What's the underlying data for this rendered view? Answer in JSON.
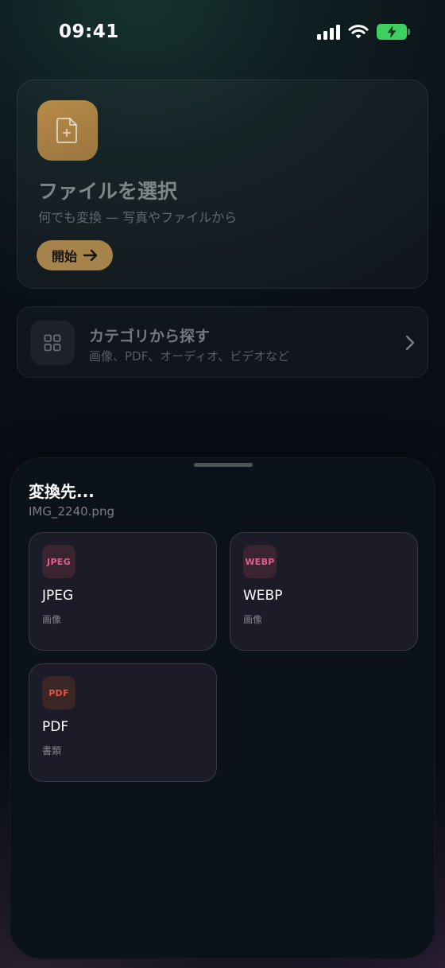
{
  "status": {
    "time": "09:41",
    "battery_color": "#3ecf62"
  },
  "picker": {
    "title": "ファイルを選択",
    "subtitle": "何でも変換 — 写真やファイルから",
    "start_label": "開始",
    "icon": "file-plus-icon",
    "accent": "#a7834c"
  },
  "category": {
    "title": "カテゴリから探す",
    "subtitle": "画像、PDF、オーディオ、ビデオなど",
    "icon": "grid-icon"
  },
  "sheet": {
    "title": "変換先...",
    "file_name": "IMG_2240.png",
    "formats": [
      {
        "badge": "JPEG",
        "name": "JPEG",
        "type": "画像",
        "color": "#e0608c",
        "bg": "#3a2430"
      },
      {
        "badge": "WEBP",
        "name": "WEBP",
        "type": "画像",
        "color": "#e0608c",
        "bg": "#3a2430"
      },
      {
        "badge": "PDF",
        "name": "PDF",
        "type": "書類",
        "color": "#e0573e",
        "bg": "#3a2624"
      }
    ]
  }
}
